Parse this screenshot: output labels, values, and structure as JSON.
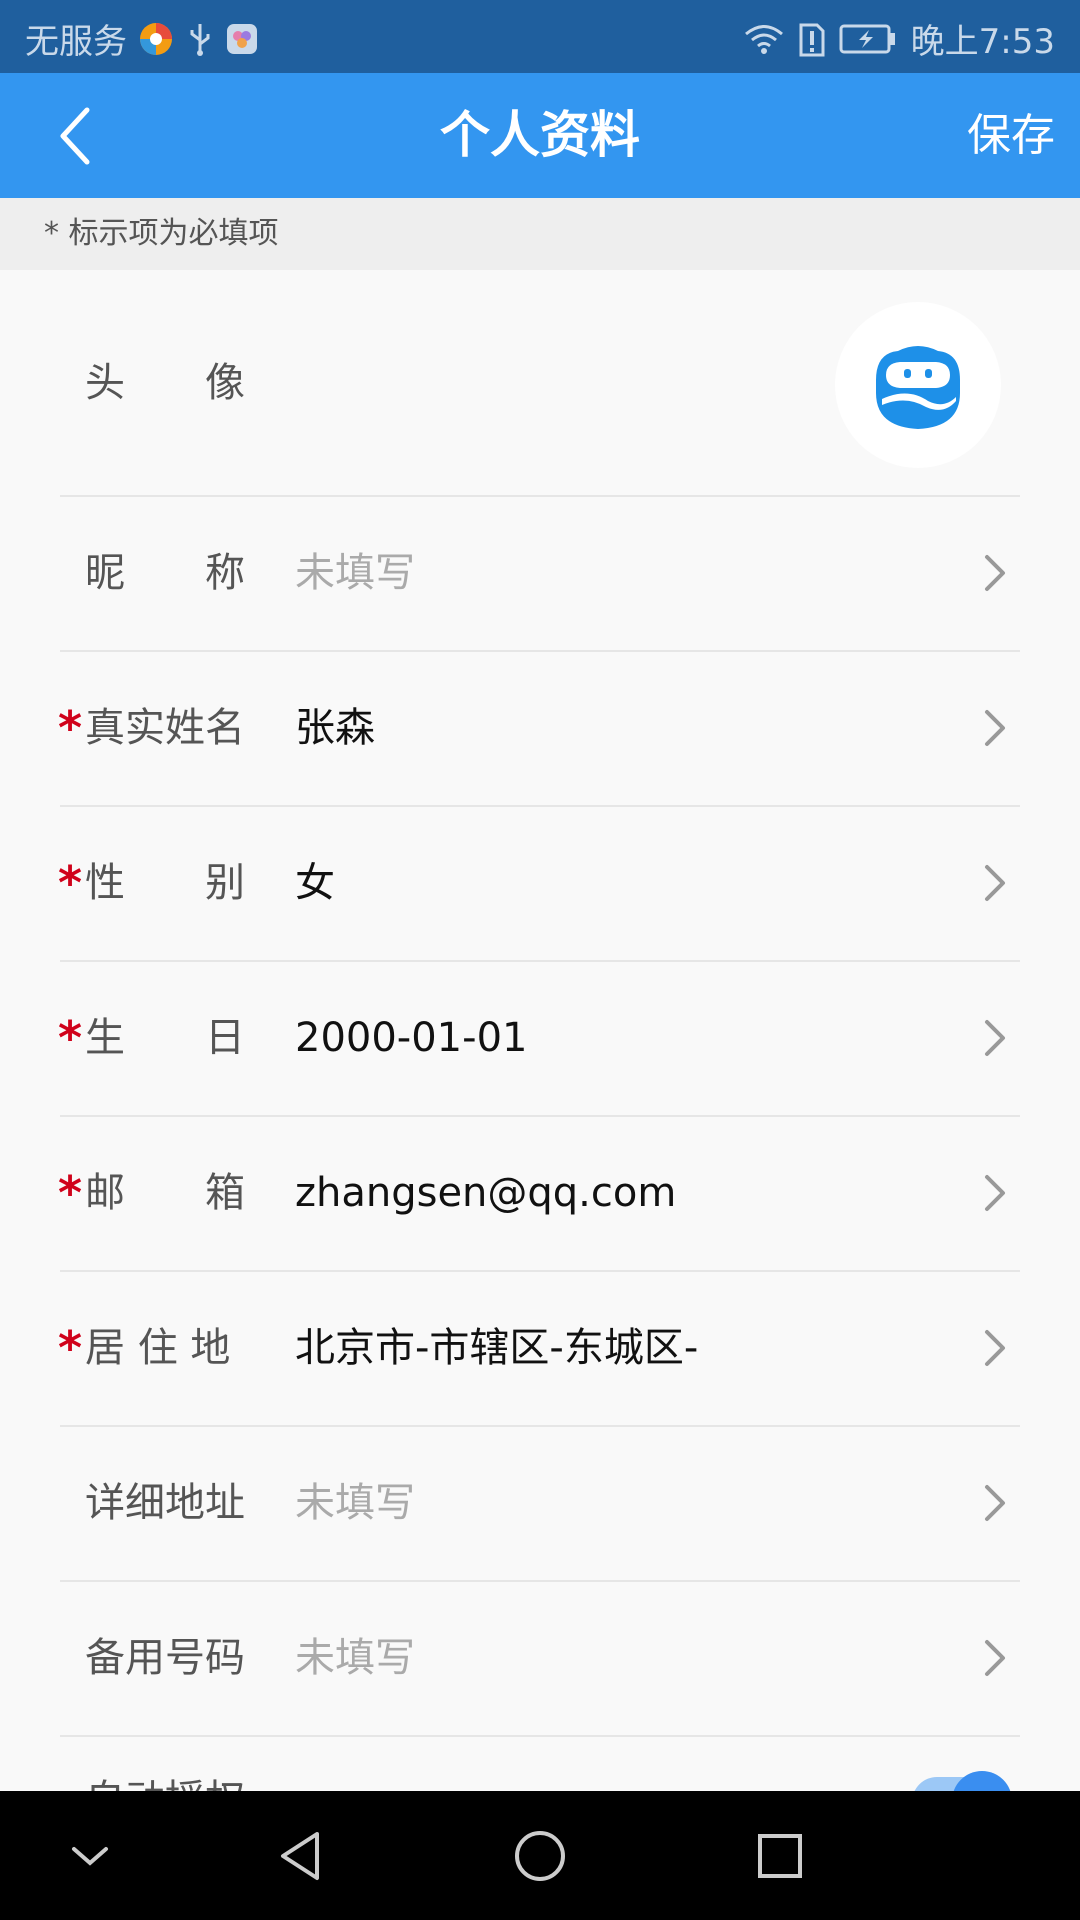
{
  "status_bar": {
    "carrier": "无服务",
    "time": "晚上7:53"
  },
  "header": {
    "title": "个人资料",
    "save_label": "保存"
  },
  "notice": "* 标示项为必填项",
  "form": {
    "avatar_label": "头　　像",
    "rows": [
      {
        "label": "昵　　称",
        "value": "未填写",
        "required": false,
        "placeholder": true
      },
      {
        "label": "真实姓名",
        "value": "张森",
        "required": true,
        "placeholder": false
      },
      {
        "label": "性　　别",
        "value": "女",
        "required": true,
        "placeholder": false
      },
      {
        "label": "生　　日",
        "value": "2000-01-01",
        "required": true,
        "placeholder": false
      },
      {
        "label": "邮　　箱",
        "value": "zhangsen@qq.com",
        "required": true,
        "placeholder": false
      },
      {
        "label": "居 住 地",
        "value": "北京市-市辖区-东城区-",
        "required": true,
        "placeholder": false
      },
      {
        "label": "详细地址",
        "value": "未填写",
        "required": false,
        "placeholder": true
      },
      {
        "label": "备用号码",
        "value": "未填写",
        "required": false,
        "placeholder": true
      }
    ],
    "partial_row_label": "自动授权",
    "partial_toggle_on": true
  },
  "colors": {
    "header": "#3396f0",
    "status_bar": "#1f5f9e",
    "required_star": "#d0021b",
    "avatar_blue": "#1e90e8"
  },
  "icons": {
    "back": "chevron-left-icon",
    "row_arrow": "chevron-right-icon",
    "nav": [
      "chevron-down-icon",
      "triangle-back-icon",
      "circle-home-icon",
      "square-recents-icon"
    ]
  }
}
